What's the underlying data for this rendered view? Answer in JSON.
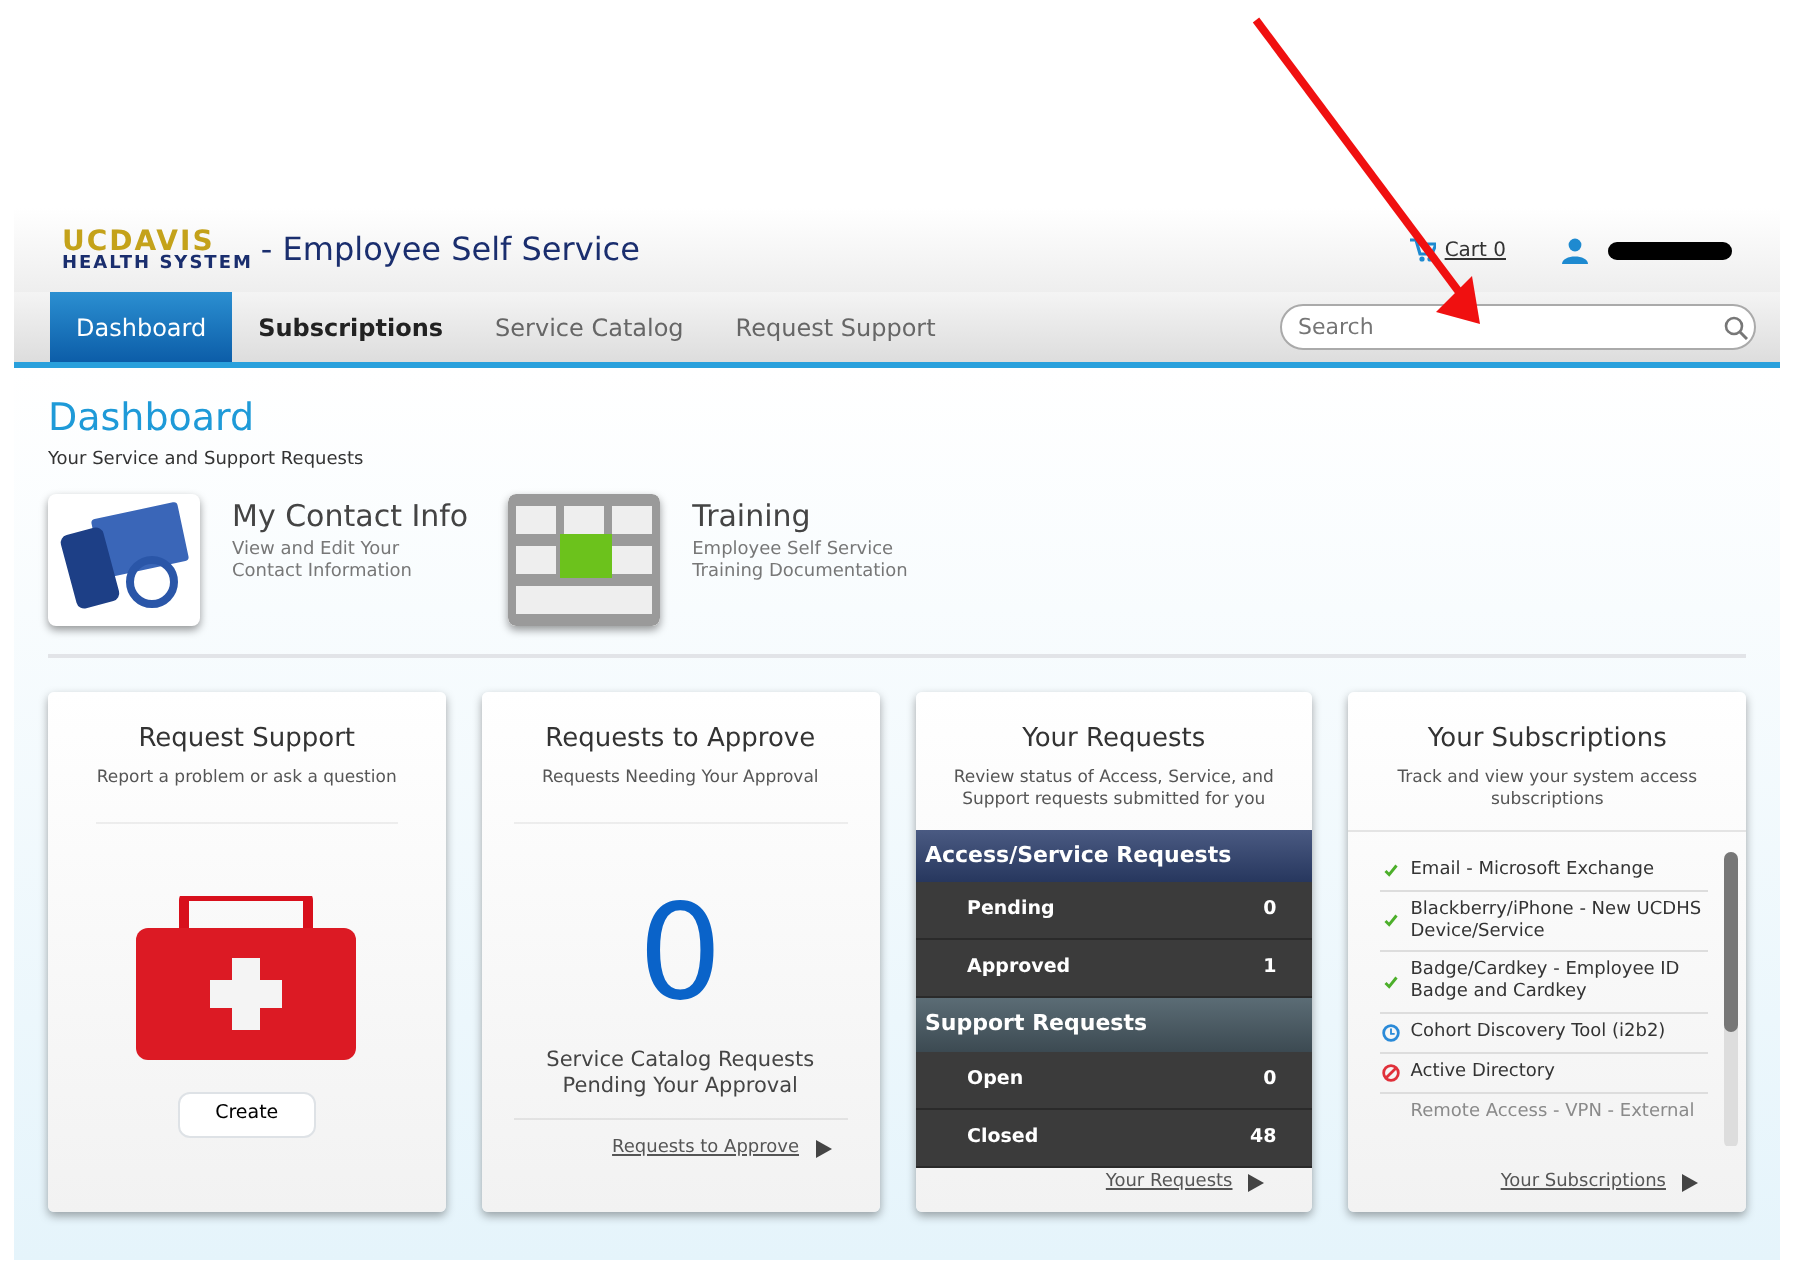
{
  "header": {
    "logo_top": "UC",
    "logo_top_bold": "DAVIS",
    "logo_bottom": "HEALTH SYSTEM",
    "title": "- Employee Self Service",
    "cart": "Cart 0"
  },
  "nav": {
    "tabs": [
      {
        "label": "Dashboard",
        "selected": true
      },
      {
        "label": "Subscriptions",
        "selected": false
      },
      {
        "label": "Service Catalog",
        "selected": false
      },
      {
        "label": "Request Support",
        "selected": false
      }
    ],
    "search": {
      "placeholder": "Search"
    }
  },
  "page": {
    "title": "Dashboard",
    "subtitle": "Your Service and Support Requests"
  },
  "shortcuts": [
    {
      "kind": "contact",
      "title": "My Contact Info",
      "description": "View and Edit Your Contact Information"
    },
    {
      "kind": "training",
      "title": "Training",
      "description": "Employee Self Service Training Documentation"
    }
  ],
  "request_support": {
    "title": "Request Support",
    "subtitle": "Report a problem or ask a question",
    "button": "Create"
  },
  "requests_to_approve": {
    "title": "Requests to Approve",
    "subtitle": "Requests Needing Your Approval",
    "count": "0",
    "caption": "Service Catalog Requests Pending Your Approval",
    "link": "Requests to Approve"
  },
  "your_requests": {
    "title": "Your Requests",
    "subtitle": "Review status of Access, Service, and Support requests submitted for you",
    "groups": [
      {
        "title": "Access/Service Requests",
        "rows": [
          {
            "label": "Pending",
            "value": "0"
          },
          {
            "label": "Approved",
            "value": "1"
          }
        ]
      },
      {
        "title": "Support Requests",
        "rows": [
          {
            "label": "Open",
            "value": "0"
          },
          {
            "label": "Closed",
            "value": "48"
          }
        ]
      }
    ],
    "link": "Your Requests"
  },
  "your_subscriptions": {
    "title": "Your Subscriptions",
    "subtitle": "Track and view your system access subscriptions",
    "items": [
      {
        "label": "Email - Microsoft Exchange",
        "kind": "active"
      },
      {
        "label": "Blackberry/iPhone - New UCDHS Device/Service",
        "kind": "active"
      },
      {
        "label": "Badge/Cardkey - Employee ID Badge and Cardkey",
        "kind": "active"
      },
      {
        "label": "Cohort Discovery Tool (i2b2)",
        "kind": "pending"
      },
      {
        "label": "Active Directory",
        "kind": "denied"
      },
      {
        "label": "Remote Access - VPN - External",
        "kind": "faded"
      }
    ],
    "link": "Your Subscriptions"
  }
}
